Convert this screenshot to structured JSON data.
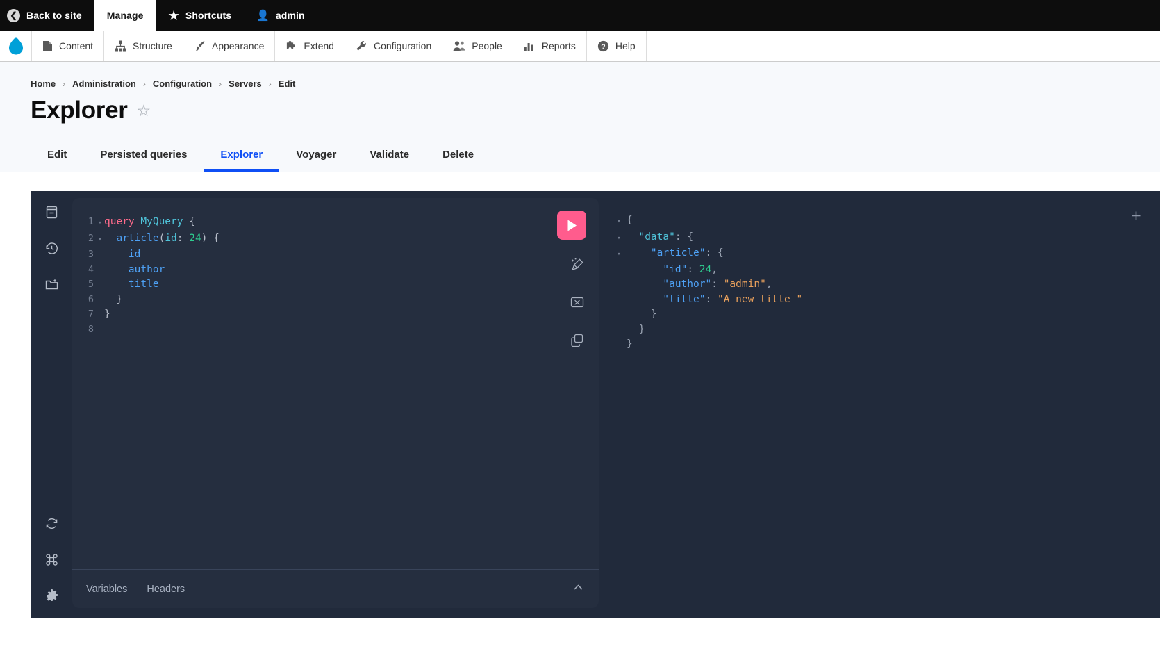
{
  "admin_bar": {
    "back_to_site": "Back to site",
    "manage": "Manage",
    "shortcuts": "Shortcuts",
    "user": "admin"
  },
  "menu": {
    "items": [
      {
        "label": "Content",
        "icon": "document-icon"
      },
      {
        "label": "Structure",
        "icon": "sitemap-icon"
      },
      {
        "label": "Appearance",
        "icon": "paintbrush-icon"
      },
      {
        "label": "Extend",
        "icon": "puzzle-icon"
      },
      {
        "label": "Configuration",
        "icon": "wrench-icon"
      },
      {
        "label": "People",
        "icon": "people-icon"
      },
      {
        "label": "Reports",
        "icon": "bar-chart-icon"
      },
      {
        "label": "Help",
        "icon": "question-circle-icon"
      }
    ]
  },
  "breadcrumb": [
    "Home",
    "Administration",
    "Configuration",
    "Servers",
    "Edit"
  ],
  "page": {
    "title": "Explorer",
    "bookmark_icon": "star-outline-icon"
  },
  "tabs": [
    {
      "label": "Edit",
      "active": false
    },
    {
      "label": "Persisted queries",
      "active": false
    },
    {
      "label": "Explorer",
      "active": true
    },
    {
      "label": "Voyager",
      "active": false
    },
    {
      "label": "Validate",
      "active": false
    },
    {
      "label": "Delete",
      "active": false
    }
  ],
  "graphiql": {
    "sidebar": [
      {
        "name": "docs-icon",
        "title": "Show Documentation Explorer"
      },
      {
        "name": "history-icon",
        "title": "Show History"
      },
      {
        "name": "folder-plus-icon",
        "title": "Open short keys"
      },
      {
        "name": "refresh-icon",
        "title": "Re-fetch GraphQL schema"
      },
      {
        "name": "command-icon",
        "title": "Open short keys dialog"
      },
      {
        "name": "gear-icon",
        "title": "Open settings dialog"
      }
    ],
    "run_button": "run-query-icon",
    "tools": [
      {
        "name": "prettify-icon",
        "title": "Prettify query"
      },
      {
        "name": "merge-icon",
        "title": "Merge fragments into query"
      },
      {
        "name": "copy-icon",
        "title": "Copy query"
      }
    ],
    "query_lines": [
      {
        "num": "1",
        "fold": "▾",
        "tokens": [
          {
            "t": "query ",
            "c": "k-query"
          },
          {
            "t": "MyQuery",
            "c": "k-name"
          },
          {
            "t": " {",
            "c": "k-punct"
          }
        ]
      },
      {
        "num": "2",
        "fold": "▾",
        "tokens": [
          {
            "t": "  ",
            "c": "k-punct"
          },
          {
            "t": "article",
            "c": "k-field"
          },
          {
            "t": "(",
            "c": "k-punct"
          },
          {
            "t": "id",
            "c": "k-arg"
          },
          {
            "t": ": ",
            "c": "k-punct"
          },
          {
            "t": "24",
            "c": "k-num"
          },
          {
            "t": ") {",
            "c": "k-punct"
          }
        ]
      },
      {
        "num": "3",
        "fold": "",
        "tokens": [
          {
            "t": "    ",
            "c": "k-punct"
          },
          {
            "t": "id",
            "c": "k-field"
          }
        ]
      },
      {
        "num": "4",
        "fold": "",
        "tokens": [
          {
            "t": "    ",
            "c": "k-punct"
          },
          {
            "t": "author",
            "c": "k-field"
          }
        ]
      },
      {
        "num": "5",
        "fold": "",
        "tokens": [
          {
            "t": "    ",
            "c": "k-punct"
          },
          {
            "t": "title",
            "c": "k-field"
          }
        ]
      },
      {
        "num": "6",
        "fold": "",
        "tokens": [
          {
            "t": "  }",
            "c": "k-punct"
          }
        ]
      },
      {
        "num": "7",
        "fold": "",
        "tokens": [
          {
            "t": "}",
            "c": "k-punct"
          }
        ]
      },
      {
        "num": "8",
        "fold": "",
        "tokens": []
      }
    ],
    "footer_tabs": [
      "Variables",
      "Headers"
    ],
    "collapse_icon": "chevron-up-icon",
    "add_tab_icon": "plus-icon",
    "response_lines": [
      {
        "fold": "▾",
        "tokens": [
          {
            "t": "{",
            "c": "k-dim"
          }
        ]
      },
      {
        "fold": "▾",
        "tokens": [
          {
            "t": "  ",
            "c": "k-dim"
          },
          {
            "t": "\"data\"",
            "c": "k-name"
          },
          {
            "t": ": {",
            "c": "k-dim"
          }
        ]
      },
      {
        "fold": "▾",
        "tokens": [
          {
            "t": "    ",
            "c": "k-dim"
          },
          {
            "t": "\"article\"",
            "c": "k-key"
          },
          {
            "t": ": {",
            "c": "k-dim"
          }
        ]
      },
      {
        "fold": "",
        "tokens": [
          {
            "t": "      ",
            "c": "k-dim"
          },
          {
            "t": "\"id\"",
            "c": "k-key"
          },
          {
            "t": ": ",
            "c": "k-dim"
          },
          {
            "t": "24",
            "c": "k-num"
          },
          {
            "t": ",",
            "c": "k-dim"
          }
        ]
      },
      {
        "fold": "",
        "tokens": [
          {
            "t": "      ",
            "c": "k-dim"
          },
          {
            "t": "\"author\"",
            "c": "k-key"
          },
          {
            "t": ": ",
            "c": "k-dim"
          },
          {
            "t": "\"admin\"",
            "c": "k-str"
          },
          {
            "t": ",",
            "c": "k-dim"
          }
        ]
      },
      {
        "fold": "",
        "tokens": [
          {
            "t": "      ",
            "c": "k-dim"
          },
          {
            "t": "\"title\"",
            "c": "k-key"
          },
          {
            "t": ": ",
            "c": "k-dim"
          },
          {
            "t": "\"A new title \"",
            "c": "k-str"
          }
        ]
      },
      {
        "fold": "",
        "tokens": [
          {
            "t": "    }",
            "c": "k-dim"
          }
        ]
      },
      {
        "fold": "",
        "tokens": [
          {
            "t": "  }",
            "c": "k-dim"
          }
        ]
      },
      {
        "fold": "",
        "tokens": [
          {
            "t": "}",
            "c": "k-dim"
          }
        ]
      }
    ]
  },
  "colors": {
    "accent_blue": "#0f4ff5",
    "run_pink": "#ff5c8d",
    "panel_bg": "#212a3b",
    "editor_bg": "#252e3f",
    "drupal_blue": "#00a0d8"
  }
}
